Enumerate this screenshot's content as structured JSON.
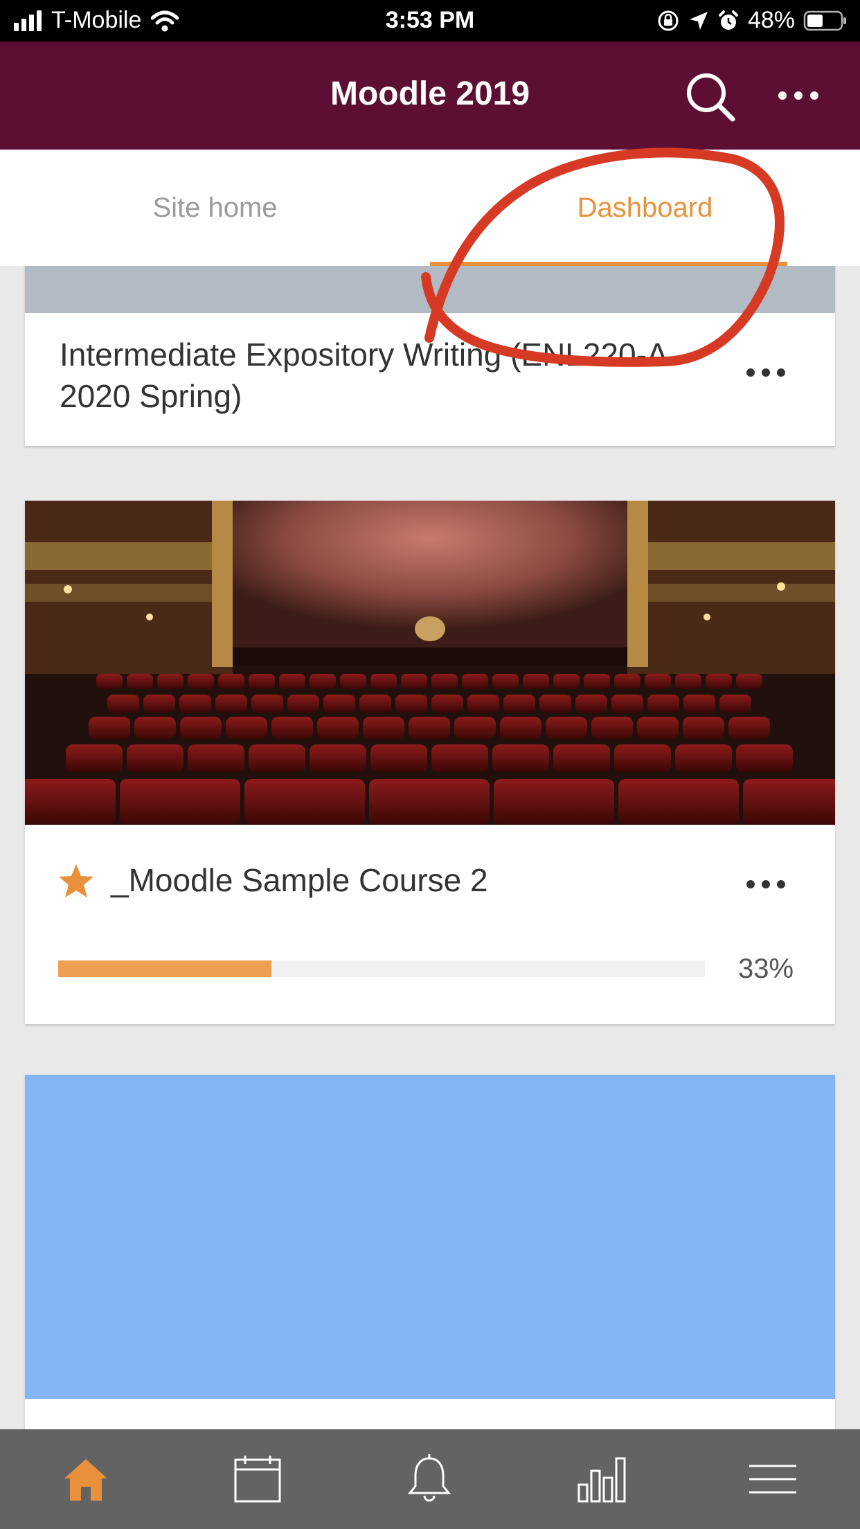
{
  "status_bar": {
    "carrier": "T-Mobile",
    "time": "3:53 PM",
    "battery": "48%",
    "battery_level": 0.48
  },
  "header": {
    "title": "Moodle 2019",
    "background": "#5d0f33"
  },
  "tabs": [
    {
      "label": "Site home",
      "active": false
    },
    {
      "label": "Dashboard",
      "active": true
    }
  ],
  "courses": [
    {
      "name": "Intermediate Expository Writing (ENL220-A 2020 Spring)",
      "image_color": "#b2bbc4"
    },
    {
      "name": "_Moodle Sample Course 2",
      "starred": true,
      "progress": 0.33,
      "progress_label": "33%",
      "image": "theater-seats-photo"
    },
    {
      "name": "",
      "image_color": "#84b4f6"
    }
  ],
  "bottom_nav": [
    {
      "icon": "home-icon",
      "active": true
    },
    {
      "icon": "calendar-icon",
      "active": false
    },
    {
      "icon": "bell-icon",
      "active": false
    },
    {
      "icon": "grades-chart-icon",
      "active": false
    },
    {
      "icon": "menu-icon",
      "active": false
    }
  ],
  "colors": {
    "accent": "#e8913a",
    "progress_fill": "#eda052",
    "annotation": "#d63a24"
  }
}
